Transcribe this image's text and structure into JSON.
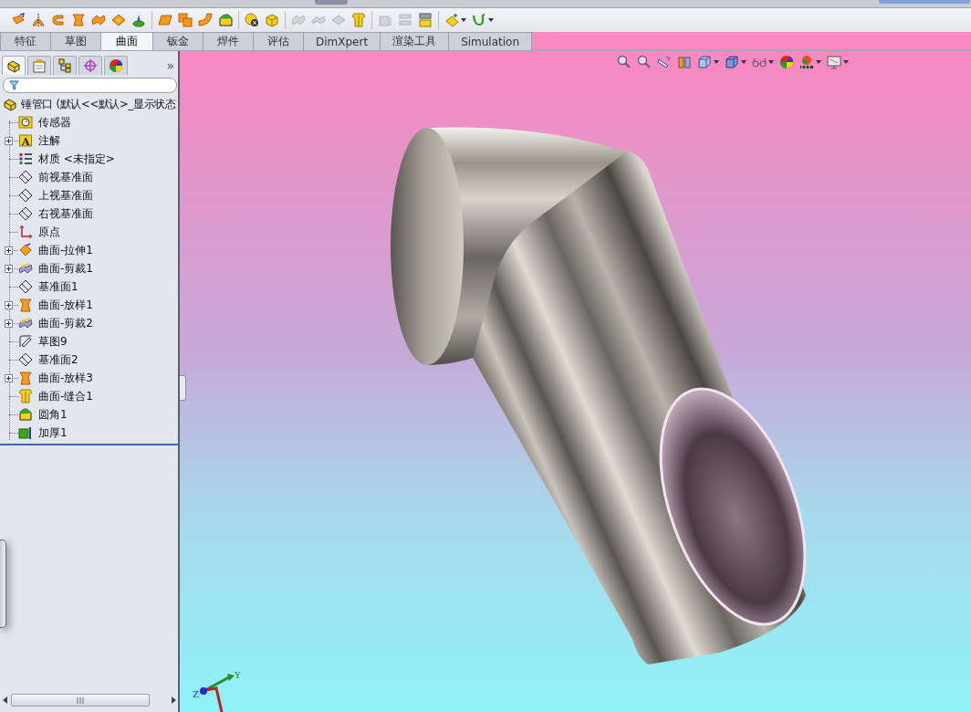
{
  "toolbar": {
    "tools": [
      {
        "disabled": false
      },
      {
        "disabled": false
      },
      {
        "disabled": false
      },
      {
        "disabled": false
      },
      {
        "disabled": false
      },
      {
        "disabled": false
      },
      {
        "disabled": false
      },
      {
        "disabled": false
      },
      {
        "disabled": false
      },
      {
        "disabled": false
      },
      {
        "disabled": false
      },
      {
        "disabled": false
      },
      {
        "disabled": false
      },
      {
        "disabled": true
      },
      {
        "disabled": true
      },
      {
        "disabled": true
      },
      {
        "disabled": false
      },
      {
        "disabled": true
      },
      {
        "disabled": true
      },
      {
        "disabled": false
      },
      {
        "disabled": false
      },
      {
        "disabled": false
      }
    ]
  },
  "command_tabs": [
    {
      "label": "特征",
      "selected": false
    },
    {
      "label": "草图",
      "selected": false
    },
    {
      "label": "曲面",
      "selected": true
    },
    {
      "label": "钣金",
      "selected": false
    },
    {
      "label": "焊件",
      "selected": false
    },
    {
      "label": "评估",
      "selected": false
    },
    {
      "label": "DimXpert",
      "selected": false
    },
    {
      "label": "渲染工具",
      "selected": false
    },
    {
      "label": "Simulation",
      "selected": false
    }
  ],
  "manager_panel": {
    "tabs": [
      {
        "selected": true
      },
      {
        "selected": false
      },
      {
        "selected": false
      },
      {
        "selected": false
      },
      {
        "selected": false
      }
    ],
    "more": "»",
    "tree": {
      "label": "锤管口 (默认<<默认>_显示状态",
      "children": [
        {
          "label": "传感器",
          "kind": "sensor"
        },
        {
          "label": "注解",
          "kind": "annotation",
          "icon_text": "A",
          "expanded": false
        },
        {
          "label": "材质 <未指定>",
          "kind": "material"
        },
        {
          "label": "前视基准面",
          "kind": "plane"
        },
        {
          "label": "上视基准面",
          "kind": "plane"
        },
        {
          "label": "右视基准面",
          "kind": "plane"
        },
        {
          "label": "原点",
          "kind": "origin"
        },
        {
          "label": "曲面-拉伸1",
          "kind": "extrude",
          "expanded": false
        },
        {
          "label": "曲面-剪裁1",
          "kind": "trim",
          "expanded": false
        },
        {
          "label": "基准面1",
          "kind": "plane"
        },
        {
          "label": "曲面-放样1",
          "kind": "loft",
          "expanded": false
        },
        {
          "label": "曲面-剪裁2",
          "kind": "trim",
          "expanded": false
        },
        {
          "label": "草图9",
          "kind": "sketch"
        },
        {
          "label": "基准面2",
          "kind": "plane"
        },
        {
          "label": "曲面-放样3",
          "kind": "loft",
          "expanded": false
        },
        {
          "label": "曲面-缝合1",
          "kind": "knit"
        },
        {
          "label": "圆角1",
          "kind": "fillet"
        },
        {
          "label": "加厚1",
          "kind": "thicken"
        }
      ]
    }
  },
  "viewport": {
    "triad": {
      "y_label": "Y",
      "z_label": "Z"
    }
  }
}
